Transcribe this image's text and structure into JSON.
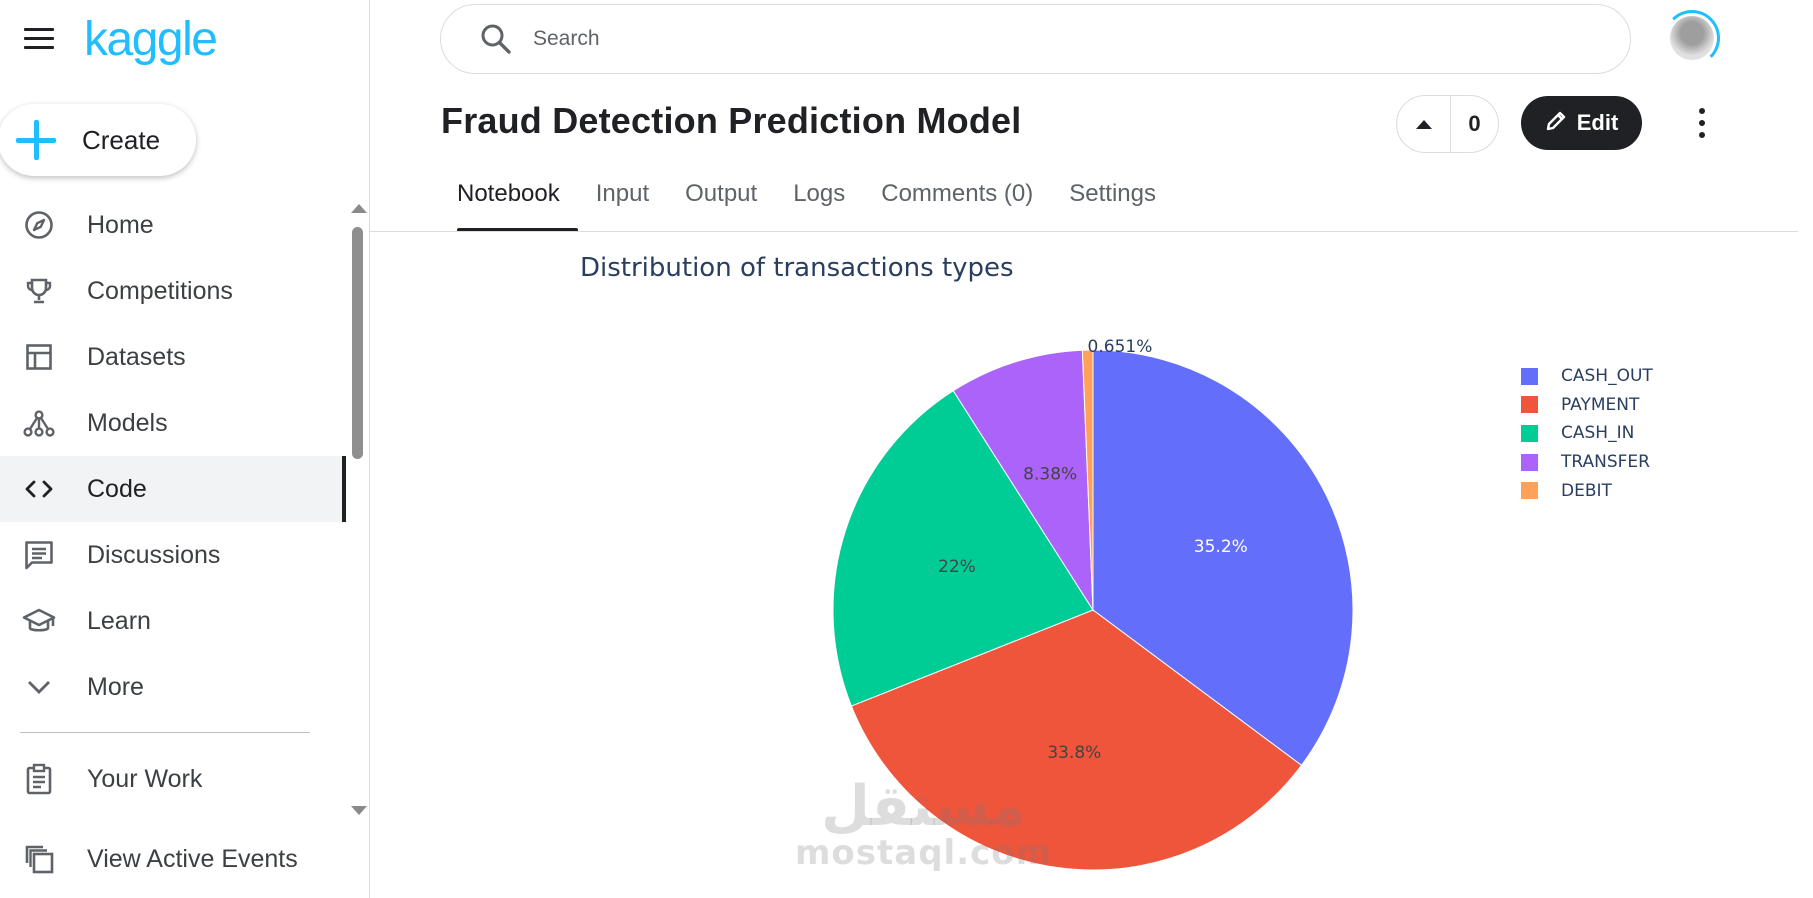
{
  "sidebar": {
    "logo": "kaggle",
    "create_label": "Create",
    "items": [
      {
        "label": "Home",
        "icon": "compass-icon"
      },
      {
        "label": "Competitions",
        "icon": "trophy-icon"
      },
      {
        "label": "Datasets",
        "icon": "table-icon"
      },
      {
        "label": "Models",
        "icon": "models-icon"
      },
      {
        "label": "Code",
        "icon": "code-icon",
        "active": true
      },
      {
        "label": "Discussions",
        "icon": "comment-icon"
      },
      {
        "label": "Learn",
        "icon": "school-icon"
      },
      {
        "label": "More",
        "icon": "chevron-down-icon"
      }
    ],
    "secondary_items": [
      {
        "label": "Your Work",
        "icon": "clipboard-icon"
      },
      {
        "label": "View Active Events",
        "icon": "events-icon"
      }
    ]
  },
  "header": {
    "search_placeholder": "Search",
    "notebook_title": "Fraud Detection Prediction Model",
    "vote_count": "0",
    "edit_label": "Edit"
  },
  "tabs": [
    {
      "label": "Notebook",
      "active": true
    },
    {
      "label": "Input"
    },
    {
      "label": "Output"
    },
    {
      "label": "Logs"
    },
    {
      "label": "Comments (0)"
    },
    {
      "label": "Settings"
    }
  ],
  "watermark": {
    "arabic": "مستقل",
    "latin": "mostaql.com"
  },
  "chart_data": {
    "type": "pie",
    "title": "Distribution of transactions types",
    "labels": [
      "CASH_OUT",
      "PAYMENT",
      "CASH_IN",
      "TRANSFER",
      "DEBIT"
    ],
    "values": [
      35.2,
      33.8,
      22.0,
      8.38,
      0.651
    ],
    "slice_labels": [
      "35.2%",
      "33.8%",
      "22%",
      "8.38%",
      "0.651%"
    ],
    "colors": [
      "#636efa",
      "#ef553b",
      "#00cc96",
      "#ab63fa",
      "#ffa15a"
    ],
    "label_colors": [
      "#ffffff",
      "#444444",
      "#444444",
      "#444444",
      "#2a3f5f"
    ],
    "legend_position": "top-right",
    "sort": "descending",
    "direction": "clockwise",
    "start": "top"
  }
}
